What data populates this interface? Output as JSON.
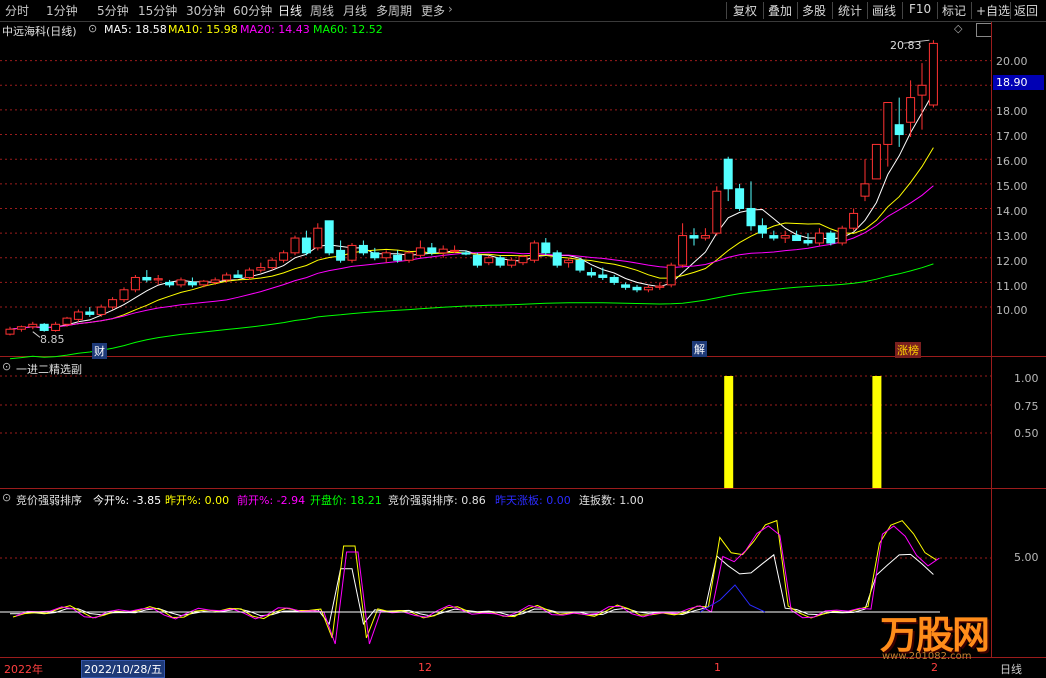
{
  "toolbar": {
    "periods": [
      "分时",
      "1分钟",
      "5分钟",
      "15分钟",
      "30分钟",
      "60分钟",
      "日线",
      "周线",
      "月线",
      "多周期",
      "更多"
    ],
    "active_period": "日线",
    "buttons": [
      "复权",
      "叠加",
      "多股",
      "统计",
      "画线",
      "F10",
      "标记",
      "+自选",
      "返回"
    ]
  },
  "main": {
    "stock_title": "中远海科(日线)",
    "ma5": "MA5: 18.58",
    "ma10": "MA10: 15.98",
    "ma20": "MA20: 14.43",
    "ma60": "MA60: 12.52",
    "high_label": "20.83",
    "low_label": "8.85",
    "current_price": "18.90",
    "yaxis": [
      "20.00",
      "19.00",
      "18.00",
      "17.00",
      "16.00",
      "15.00",
      "14.00",
      "13.00",
      "12.00",
      "11.00",
      "10.00"
    ],
    "markers": [
      "财",
      "解",
      "涨榜"
    ]
  },
  "sub1": {
    "title": "一进二精选副",
    "yaxis": [
      "1.00",
      "0.75",
      "0.50"
    ],
    "signal_values": [
      1,
      1
    ]
  },
  "sub2": {
    "title": "竞价强弱排序",
    "jinkai": "今开%: -3.85",
    "zuokai": "昨开%: 0.00",
    "qiankai": "前开%: -2.94",
    "kaipan": "开盘价: 18.21",
    "qiangruo": "竞价强弱排序: 0.86",
    "zuotian": "昨天涨板: 0.00",
    "lianban": "连扳数: 1.00",
    "yaxis": [
      "5.00"
    ]
  },
  "xaxis": {
    "year": "2022年",
    "date": "2022/10/28/五",
    "month_12": "12",
    "month_1": "1",
    "month_2": "2",
    "period_label": "日线"
  },
  "watermark": {
    "brand": "万股网",
    "url": "www.201082.com"
  },
  "colors": {
    "up": "#ff3232",
    "down": "#54ffff",
    "ma5": "#ffffff",
    "ma10": "#ffff00",
    "ma20": "#ff00ff",
    "ma60": "#00ff00",
    "signal": "#ffff00",
    "grid": "#9b1c1c"
  },
  "chart_data": {
    "type": "candlestick",
    "candles": [
      [
        8.9,
        9.2,
        8.85,
        9.1
      ],
      [
        9.1,
        9.25,
        9.0,
        9.2
      ],
      [
        9.2,
        9.4,
        9.1,
        9.3
      ],
      [
        9.3,
        9.35,
        9.0,
        9.05
      ],
      [
        9.05,
        9.4,
        9.0,
        9.3
      ],
      [
        9.3,
        9.6,
        9.2,
        9.55
      ],
      [
        9.5,
        9.9,
        9.4,
        9.8
      ],
      [
        9.8,
        10.0,
        9.6,
        9.7
      ],
      [
        9.7,
        10.1,
        9.6,
        10.0
      ],
      [
        10.0,
        10.4,
        9.9,
        10.3
      ],
      [
        10.3,
        10.8,
        10.2,
        10.7
      ],
      [
        10.7,
        11.3,
        10.6,
        11.2
      ],
      [
        11.2,
        11.5,
        11.0,
        11.1
      ],
      [
        11.1,
        11.3,
        10.9,
        11.15
      ],
      [
        11.0,
        11.1,
        10.8,
        10.9
      ],
      [
        10.9,
        11.2,
        10.8,
        11.1
      ],
      [
        11.0,
        11.2,
        10.8,
        10.9
      ],
      [
        10.9,
        11.1,
        10.8,
        11.05
      ],
      [
        11.0,
        11.2,
        10.9,
        11.1
      ],
      [
        11.1,
        11.4,
        11.0,
        11.3
      ],
      [
        11.3,
        11.5,
        11.2,
        11.2
      ],
      [
        11.2,
        11.6,
        11.1,
        11.5
      ],
      [
        11.5,
        11.8,
        11.4,
        11.6
      ],
      [
        11.6,
        12.0,
        11.5,
        11.9
      ],
      [
        11.9,
        12.3,
        11.8,
        12.2
      ],
      [
        12.2,
        12.9,
        12.1,
        12.8
      ],
      [
        12.8,
        13.1,
        12.1,
        12.2
      ],
      [
        12.4,
        13.4,
        12.3,
        13.2
      ],
      [
        13.5,
        13.5,
        12.1,
        12.2
      ],
      [
        12.3,
        12.7,
        11.8,
        11.9
      ],
      [
        11.9,
        12.6,
        11.8,
        12.5
      ],
      [
        12.5,
        12.7,
        12.1,
        12.2
      ],
      [
        12.2,
        12.4,
        11.9,
        12.0
      ],
      [
        12.0,
        12.3,
        11.8,
        12.2
      ],
      [
        12.1,
        12.3,
        11.8,
        11.9
      ],
      [
        11.9,
        12.3,
        11.8,
        12.2
      ],
      [
        12.1,
        12.7,
        12.0,
        12.4
      ],
      [
        12.4,
        12.6,
        12.1,
        12.2
      ],
      [
        12.2,
        12.5,
        12.0,
        12.35
      ],
      [
        12.3,
        12.5,
        12.2,
        12.3
      ],
      [
        12.2,
        12.3,
        12.1,
        12.15
      ],
      [
        12.1,
        12.2,
        11.6,
        11.7
      ],
      [
        11.8,
        12.1,
        11.7,
        12.0
      ],
      [
        12.0,
        12.1,
        11.6,
        11.7
      ],
      [
        11.7,
        12.0,
        11.6,
        11.9
      ],
      [
        11.8,
        12.1,
        11.7,
        12.05
      ],
      [
        11.9,
        12.7,
        11.8,
        12.6
      ],
      [
        12.6,
        12.8,
        12.1,
        12.2
      ],
      [
        12.2,
        12.3,
        11.6,
        11.7
      ],
      [
        11.8,
        12.0,
        11.6,
        11.9
      ],
      [
        11.9,
        12.0,
        11.4,
        11.5
      ],
      [
        11.4,
        11.6,
        11.2,
        11.3
      ],
      [
        11.3,
        11.6,
        11.1,
        11.2
      ],
      [
        11.2,
        11.3,
        10.9,
        11.0
      ],
      [
        10.9,
        11.0,
        10.7,
        10.8
      ],
      [
        10.8,
        10.9,
        10.6,
        10.7
      ],
      [
        10.7,
        10.9,
        10.6,
        10.8
      ],
      [
        10.8,
        11.0,
        10.7,
        10.85
      ],
      [
        10.9,
        11.8,
        10.8,
        11.7
      ],
      [
        11.7,
        13.4,
        11.6,
        12.9
      ],
      [
        12.9,
        13.2,
        12.5,
        12.8
      ],
      [
        12.8,
        13.2,
        12.7,
        12.9
      ],
      [
        13.0,
        14.9,
        12.9,
        14.7
      ],
      [
        16.0,
        16.1,
        14.3,
        14.8
      ],
      [
        14.8,
        15.0,
        13.9,
        14.0
      ],
      [
        14.0,
        15.1,
        13.1,
        13.3
      ],
      [
        13.3,
        13.6,
        12.8,
        13.0
      ],
      [
        12.9,
        13.1,
        12.7,
        12.8
      ],
      [
        12.8,
        13.1,
        12.6,
        12.9
      ],
      [
        12.9,
        13.1,
        12.7,
        12.7
      ],
      [
        12.7,
        13.0,
        12.5,
        12.6
      ],
      [
        12.6,
        13.2,
        12.5,
        13.0
      ],
      [
        13.0,
        13.1,
        12.5,
        12.6
      ],
      [
        12.6,
        13.3,
        12.5,
        13.2
      ],
      [
        13.2,
        14.0,
        13.1,
        13.8
      ],
      [
        14.5,
        16.0,
        14.3,
        15.0
      ],
      [
        15.2,
        15.2,
        16.6,
        16.6
      ],
      [
        16.6,
        18.3,
        15.7,
        18.3
      ],
      [
        17.4,
        18.5,
        16.5,
        17.0
      ],
      [
        17.5,
        19.2,
        16.9,
        18.5
      ],
      [
        18.6,
        19.9,
        17.2,
        19.0
      ],
      [
        18.2,
        20.83,
        18.1,
        20.7
      ]
    ],
    "ylim": [
      8.5,
      21.0
    ],
    "ma_series": [
      "MA5",
      "MA10",
      "MA20",
      "MA60"
    ]
  }
}
